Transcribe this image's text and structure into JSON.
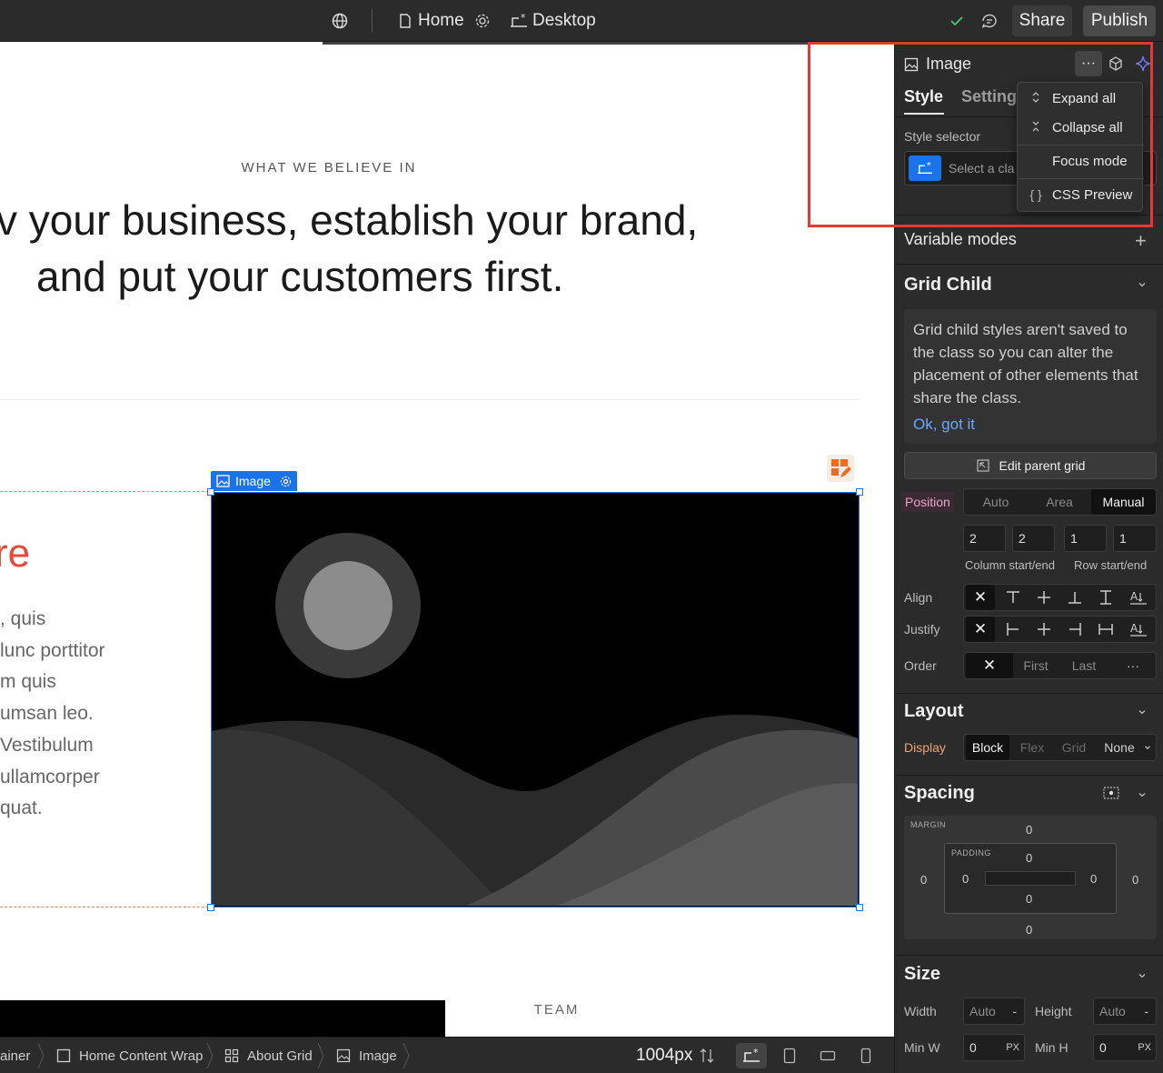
{
  "topbar": {
    "home_label": "Home",
    "device_label": "Desktop",
    "share_label": "Share",
    "publish_label": "Publish"
  },
  "canvas": {
    "eyebrow": "WHAT WE BELIEVE IN",
    "headline_line1": "v your business, establish your brand,",
    "headline_line2": "and put your customers first.",
    "red_word": "re",
    "body_lines": [
      ", quis",
      "lunc porttitor",
      "m quis",
      "umsan leo.",
      "Vestibulum",
      "ullamcorper",
      "quat."
    ],
    "image_tag": "Image",
    "team_label": "TEAM"
  },
  "breadcrumb": {
    "items": [
      "ainer",
      "Home Content Wrap",
      "About Grid",
      "Image"
    ],
    "width_readout": "1004px"
  },
  "panel": {
    "element_title": "Image",
    "tabs": [
      "Style",
      "Setting"
    ],
    "style_selector_label": "Style selector",
    "style_selector_placeholder": "Select a cla",
    "variable_modes": "Variable modes",
    "grid_child": {
      "title": "Grid Child",
      "info_text": "Grid child styles aren't saved to the class so you can alter the placement of other elements that share the class.",
      "info_link": "Ok, got it",
      "edit_parent": "Edit parent grid",
      "position_label": "Position",
      "position_options": [
        "Auto",
        "Area",
        "Manual"
      ],
      "position_selected": "Manual",
      "column_start": "2",
      "column_end": "2",
      "row_start": "1",
      "row_end": "1",
      "column_caption": "Column start/end",
      "row_caption": "Row start/end",
      "align_label": "Align",
      "justify_label": "Justify",
      "order_label": "Order",
      "order_options": [
        "First",
        "Last"
      ]
    },
    "layout": {
      "title": "Layout",
      "display_label": "Display",
      "display_options": [
        "Block",
        "Flex",
        "Grid",
        "None"
      ],
      "display_selected": "Block"
    },
    "spacing": {
      "title": "Spacing",
      "margin_label": "MARGIN",
      "padding_label": "PADDING",
      "margin": {
        "top": "0",
        "right": "0",
        "bottom": "0",
        "left": "0"
      },
      "padding": {
        "top": "0",
        "right": "0",
        "bottom": "0",
        "left": "0"
      }
    },
    "size": {
      "title": "Size",
      "width_label": "Width",
      "width_value": "Auto",
      "height_label": "Height",
      "height_value": "Auto",
      "min_w_label": "Min W",
      "min_w_value": "0",
      "min_h_label": "Min H",
      "min_h_value": "0",
      "unit": "PX",
      "dash": "-"
    }
  },
  "menu": {
    "items": [
      {
        "icon": "expand-icon",
        "label": "Expand all"
      },
      {
        "icon": "collapse-icon",
        "label": "Collapse all"
      },
      {
        "icon": "",
        "label": "Focus mode"
      },
      {
        "icon": "braces-icon",
        "label": "CSS Preview"
      }
    ]
  },
  "colors": {
    "selection_blue": "#1a73e8",
    "highlight_red": "#e53935",
    "accent_red_text": "#e8473a",
    "link_blue": "#6aa8ff"
  }
}
